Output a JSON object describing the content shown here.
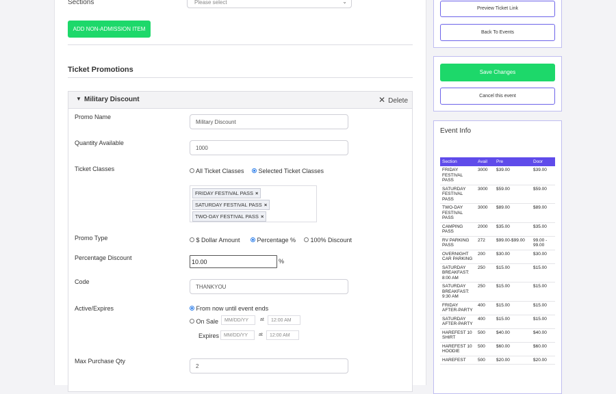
{
  "form": {
    "sections_label": "Sections",
    "sections_select": "Please select",
    "add_button": "ADD NON-ADMISSION ITEM",
    "promotions_title": "Ticket Promotions"
  },
  "promo": {
    "title": "Military Discount",
    "delete_label": "Delete",
    "labels": {
      "promo_name": "Promo Name",
      "quantity": "Quantity Available",
      "ticket_classes": "Ticket Classes",
      "promo_type": "Promo Type",
      "percentage_discount": "Percentage Discount",
      "code": "Code",
      "active_expires": "Active/Expires",
      "max_purchase": "Max Purchase Qty"
    },
    "values": {
      "promo_name": "Military Discount",
      "quantity": "1000",
      "percentage": "10.00",
      "code": "THANKYOU",
      "max_purchase": "2"
    },
    "ticket_class_options": [
      "All Ticket Classes",
      "Selected Ticket Classes"
    ],
    "selected_classes": [
      "FRIDAY FESTIVAL PASS",
      "SATURDAY FESTIVAL PASS",
      "TWO-DAY FESTIVAL PASS"
    ],
    "promo_type_options": [
      "$ Dollar Amount",
      "Percentage %",
      "100% Discount"
    ],
    "percent_sign": "%",
    "active_options": {
      "from_now": "From now until event ends",
      "on_sale": "On Sale",
      "expires": "Expires",
      "date_placeholder": "MM/DD/YY",
      "at": "at",
      "time_placeholder": "12:00 AM"
    }
  },
  "sidebar": {
    "preview_link": "Preview Ticket Link",
    "back_to_events": "Back To Events",
    "save_changes": "Save Changes",
    "cancel_event": "Cancel this event",
    "event_info_title": "Event Info",
    "table_headers": [
      "Section",
      "Avail",
      "Pre",
      "Door"
    ],
    "rows": [
      {
        "section": "FRIDAY FESTIVAL PASS",
        "avail": "3000",
        "pre": "$39.00",
        "door": "$39.00"
      },
      {
        "section": "SATURDAY FESTIVAL PASS",
        "avail": "3000",
        "pre": "$59.00",
        "door": "$59.00"
      },
      {
        "section": "TWO-DAY FESTIVAL PASS",
        "avail": "3000",
        "pre": "$89.00",
        "door": "$89.00"
      },
      {
        "section": "CAMPING PASS",
        "avail": "2000",
        "pre": "$35.00",
        "door": "$35.00"
      },
      {
        "section": "RV PARKING PASS",
        "avail": "272",
        "pre": "$99.00-$99.00",
        "door": "99.00 - 99.00"
      },
      {
        "section": "OVERNIGHT CAR PARKING",
        "avail": "200",
        "pre": "$30.00",
        "door": "$30.00"
      },
      {
        "section": "SATURDAY BREAKFAST: 8:00 AM",
        "avail": "250",
        "pre": "$15.00",
        "door": "$15.00"
      },
      {
        "section": "SATURDAY BREAKFAST: 9:30 AM",
        "avail": "250",
        "pre": "$15.00",
        "door": "$15.00"
      },
      {
        "section": "FRIDAY AFTER-PARTY",
        "avail": "400",
        "pre": "$15.00",
        "door": "$15.00"
      },
      {
        "section": "SATURDAY AFTER-PARTY",
        "avail": "400",
        "pre": "$15.00",
        "door": "$15.00"
      },
      {
        "section": "HAREFEST 10 SHIRT",
        "avail": "500",
        "pre": "$40.00",
        "door": "$40.00"
      },
      {
        "section": "HAREFEST 10 HOODIE",
        "avail": "500",
        "pre": "$60.00",
        "door": "$60.00"
      },
      {
        "section": "HAREFEST",
        "avail": "500",
        "pre": "$20.00",
        "door": "$20.00"
      }
    ]
  }
}
